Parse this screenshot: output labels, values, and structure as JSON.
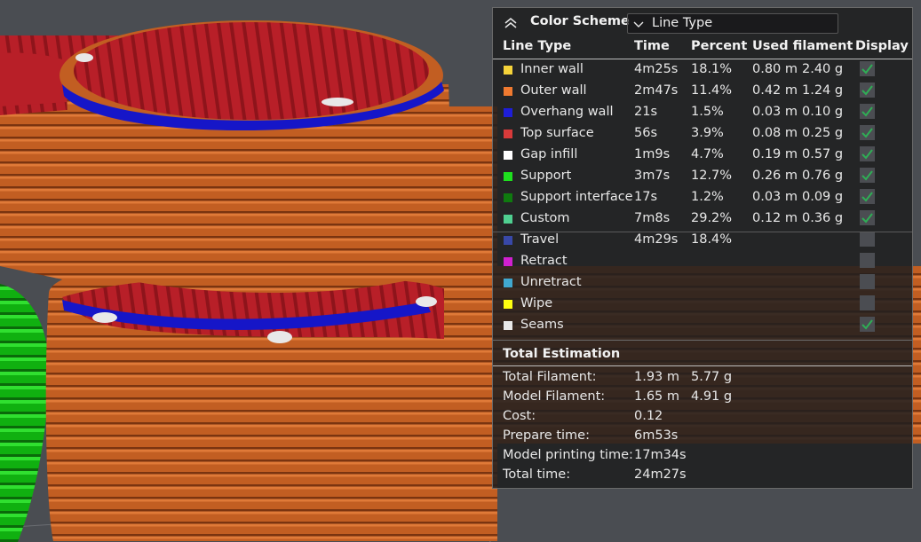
{
  "legend": {
    "title": "Color Scheme",
    "selected": "Line Type",
    "columns": {
      "type": "Line Type",
      "time": "Time",
      "percent": "Percent",
      "used": "Used filament",
      "display": "Display"
    },
    "rows": [
      {
        "name": "Inner wall",
        "color": "#f5d33a",
        "time": "4m25s",
        "percent": "18.1%",
        "meters": "0.80 m",
        "grams": "2.40 g",
        "checked": true
      },
      {
        "name": "Outer wall",
        "color": "#f07a30",
        "time": "2m47s",
        "percent": "11.4%",
        "meters": "0.42 m",
        "grams": "1.24 g",
        "checked": true
      },
      {
        "name": "Overhang wall",
        "color": "#1e1ed8",
        "time": "21s",
        "percent": "1.5%",
        "meters": "0.03 m",
        "grams": "0.10 g",
        "checked": true
      },
      {
        "name": "Top surface",
        "color": "#d83a3a",
        "time": "56s",
        "percent": "3.9%",
        "meters": "0.08 m",
        "grams": "0.25 g",
        "checked": true
      },
      {
        "name": "Gap infill",
        "color": "#ffffff",
        "time": "1m9s",
        "percent": "4.7%",
        "meters": "0.19 m",
        "grams": "0.57 g",
        "checked": true
      },
      {
        "name": "Support",
        "color": "#1ee01e",
        "time": "3m7s",
        "percent": "12.7%",
        "meters": "0.26 m",
        "grams": "0.76 g",
        "checked": true
      },
      {
        "name": "Support interface",
        "color": "#0f7a0f",
        "time": "17s",
        "percent": "1.2%",
        "meters": "0.03 m",
        "grams": "0.09 g",
        "checked": true
      },
      {
        "name": "Custom",
        "color": "#4fcf90",
        "time": "7m8s",
        "percent": "29.2%",
        "meters": "0.12 m",
        "grams": "0.36 g",
        "checked": true
      },
      {
        "name": "Travel",
        "color": "#3848a8",
        "time": "4m29s",
        "percent": "18.4%",
        "meters": "",
        "grams": "",
        "checked": false
      },
      {
        "name": "Retract",
        "color": "#d020d0",
        "time": "",
        "percent": "",
        "meters": "",
        "grams": "",
        "checked": false
      },
      {
        "name": "Unretract",
        "color": "#40a8d0",
        "time": "",
        "percent": "",
        "meters": "",
        "grams": "",
        "checked": false
      },
      {
        "name": "Wipe",
        "color": "#ffff10",
        "time": "",
        "percent": "",
        "meters": "",
        "grams": "",
        "checked": false
      },
      {
        "name": "Seams",
        "color": "#e8e8e8",
        "time": "",
        "percent": "",
        "meters": "",
        "grams": "",
        "checked": true
      }
    ],
    "estimation": {
      "title": "Total Estimation",
      "rows": [
        {
          "label": "Total Filament:",
          "value": "1.93 m",
          "value2": "5.77 g"
        },
        {
          "label": "Model Filament:",
          "value": "1.65 m",
          "value2": "4.91 g"
        },
        {
          "label": "Cost:",
          "value": "0.12",
          "value2": ""
        },
        {
          "label": "Prepare time:",
          "value": "6m53s",
          "value2": ""
        },
        {
          "label": "Model printing time:",
          "value": "17m34s",
          "value2": ""
        },
        {
          "label": "Total time:",
          "value": "24m27s",
          "value2": ""
        }
      ]
    }
  }
}
